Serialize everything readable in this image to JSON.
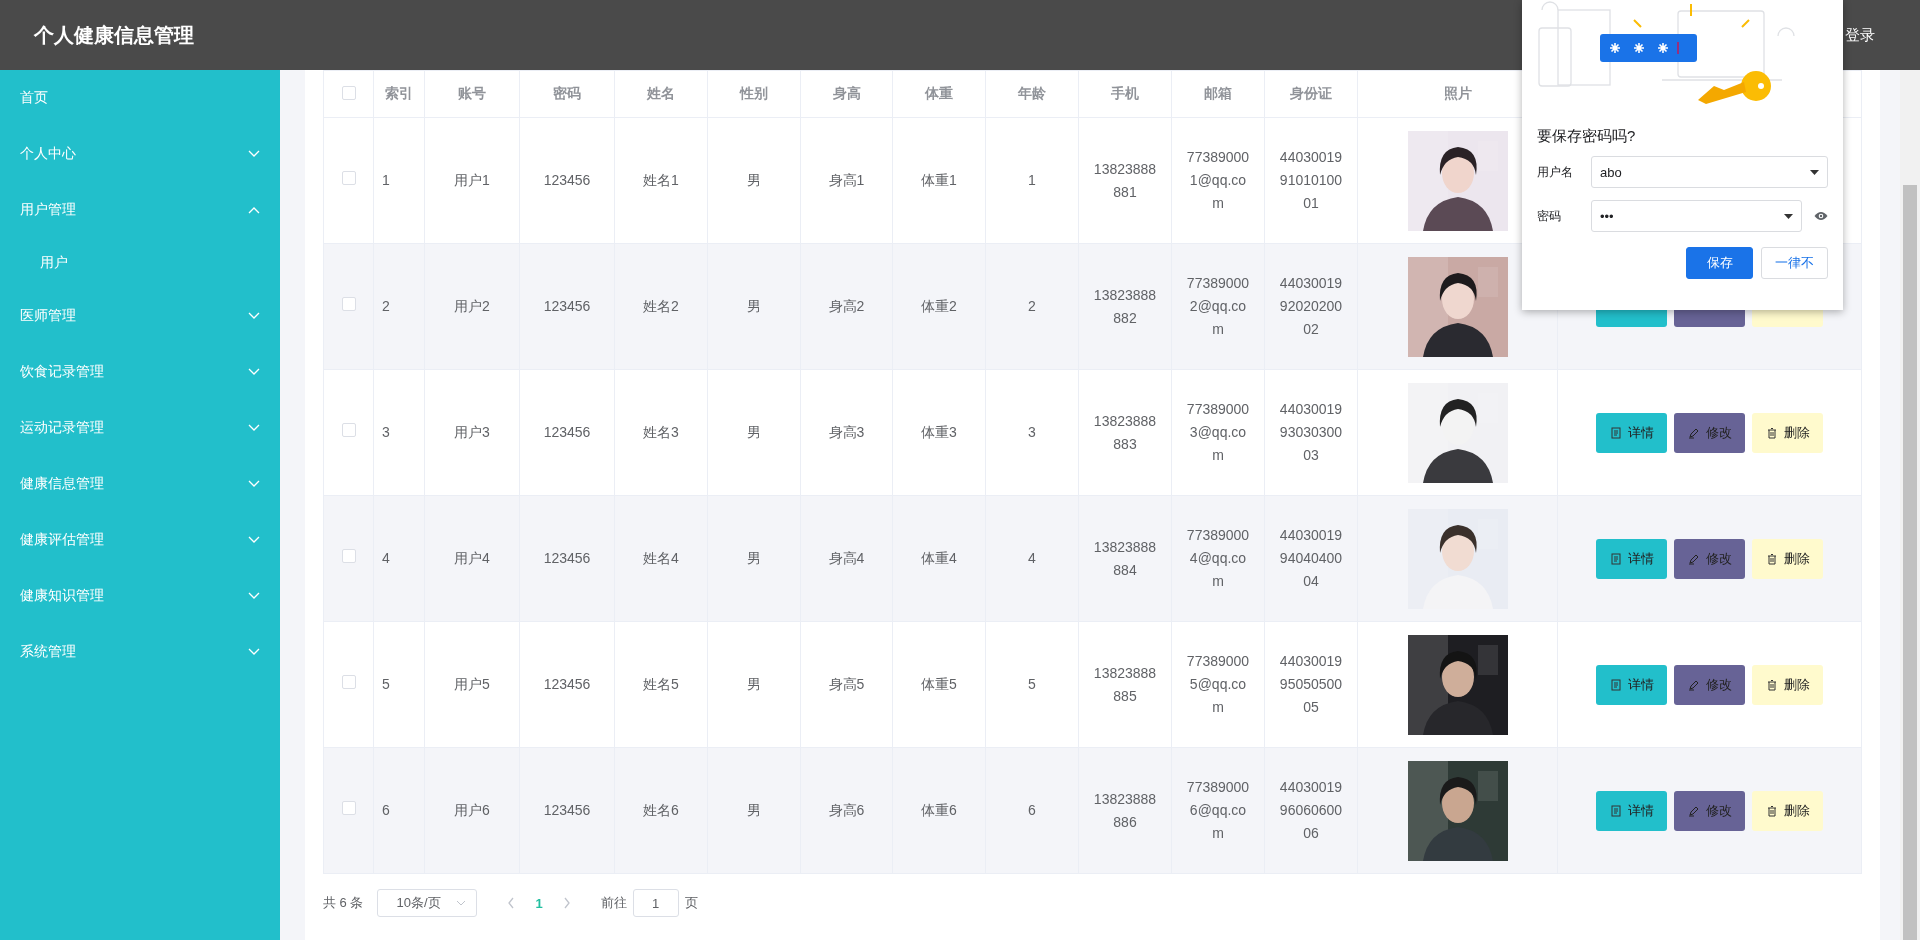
{
  "header": {
    "title": "个人健康信息管理",
    "login": "登录"
  },
  "sidebar": {
    "items": [
      {
        "label": "首页",
        "kind": "link"
      },
      {
        "label": "个人中心",
        "kind": "submenu",
        "expanded": false
      },
      {
        "label": "用户管理",
        "kind": "submenu",
        "expanded": true,
        "children": [
          {
            "label": "用户"
          }
        ]
      },
      {
        "label": "医师管理",
        "kind": "submenu",
        "expanded": false
      },
      {
        "label": "饮食记录管理",
        "kind": "submenu",
        "expanded": false
      },
      {
        "label": "运动记录管理",
        "kind": "submenu",
        "expanded": false
      },
      {
        "label": "健康信息管理",
        "kind": "submenu",
        "expanded": false
      },
      {
        "label": "健康评估管理",
        "kind": "submenu",
        "expanded": false
      },
      {
        "label": "健康知识管理",
        "kind": "submenu",
        "expanded": false
      },
      {
        "label": "系统管理",
        "kind": "submenu",
        "expanded": false
      }
    ]
  },
  "table": {
    "select_all": {
      "checked": false
    },
    "columns": [
      "索引",
      "账号",
      "密码",
      "姓名",
      "性别",
      "身高",
      "体重",
      "年龄",
      "手机",
      "邮箱",
      "身份证",
      "照片"
    ],
    "rows": [
      {
        "checked": false,
        "cells": [
          "1",
          "用户1",
          "123456",
          "姓名1",
          "男",
          "身高1",
          "体重1",
          "1",
          "13823888881",
          "773890001@qq.com",
          "440300199101010001"
        ],
        "photo": {
          "kind": "picture"
        }
      },
      {
        "checked": false,
        "cells": [
          "2",
          "用户2",
          "123456",
          "姓名2",
          "男",
          "身高2",
          "体重2",
          "2",
          "13823888882",
          "773890002@qq.com",
          "440300199202020002"
        ],
        "photo": {
          "kind": "picture"
        },
        "actions": [
          {
            "kind": "detail"
          },
          {
            "kind": "edit"
          },
          {
            "kind": "delete"
          }
        ]
      },
      {
        "checked": false,
        "cells": [
          "3",
          "用户3",
          "123456",
          "姓名3",
          "男",
          "身高3",
          "体重3",
          "3",
          "13823888883",
          "773890003@qq.com",
          "440300199303030003"
        ],
        "photo": {
          "kind": "picture"
        },
        "actions": [
          {
            "kind": "detail",
            "label": "详情"
          },
          {
            "kind": "edit",
            "label": "修改"
          },
          {
            "kind": "delete",
            "label": "删除"
          }
        ]
      },
      {
        "checked": false,
        "cells": [
          "4",
          "用户4",
          "123456",
          "姓名4",
          "男",
          "身高4",
          "体重4",
          "4",
          "13823888884",
          "773890004@qq.com",
          "440300199404040004"
        ],
        "photo": {
          "kind": "picture"
        },
        "actions": [
          {
            "kind": "detail",
            "label": "详情"
          },
          {
            "kind": "edit",
            "label": "修改"
          },
          {
            "kind": "delete",
            "label": "删除"
          }
        ]
      },
      {
        "checked": false,
        "cells": [
          "5",
          "用户5",
          "123456",
          "姓名5",
          "男",
          "身高5",
          "体重5",
          "5",
          "13823888885",
          "773890005@qq.com",
          "440300199505050005"
        ],
        "photo": {
          "kind": "picture"
        },
        "actions": [
          {
            "kind": "detail",
            "label": "详情"
          },
          {
            "kind": "edit",
            "label": "修改"
          },
          {
            "kind": "delete",
            "label": "删除"
          }
        ]
      },
      {
        "checked": false,
        "cells": [
          "6",
          "用户6",
          "123456",
          "姓名6",
          "男",
          "身高6",
          "体重6",
          "6",
          "13823888886",
          "773890006@qq.com",
          "440300199606060006"
        ],
        "photo": {
          "kind": "picture"
        },
        "actions": [
          {
            "kind": "detail",
            "label": "详情"
          },
          {
            "kind": "edit",
            "label": "修改"
          },
          {
            "kind": "delete",
            "label": "删除"
          }
        ]
      }
    ]
  },
  "pagination": {
    "total": "共 6 条",
    "page_size": "10条/页",
    "pages": [
      {
        "label": "1",
        "selected": true
      }
    ],
    "goto_label": "前往",
    "goto_value": "1",
    "goto_suffix": "页"
  },
  "save_password": {
    "title": "要保存密码吗?",
    "username_label": "用户名",
    "username": "abo",
    "password_label": "密码",
    "password": "•••",
    "buttons": [
      {
        "kind": "primary",
        "label": "保存"
      },
      {
        "kind": "secondary",
        "label": "一律不"
      }
    ]
  }
}
